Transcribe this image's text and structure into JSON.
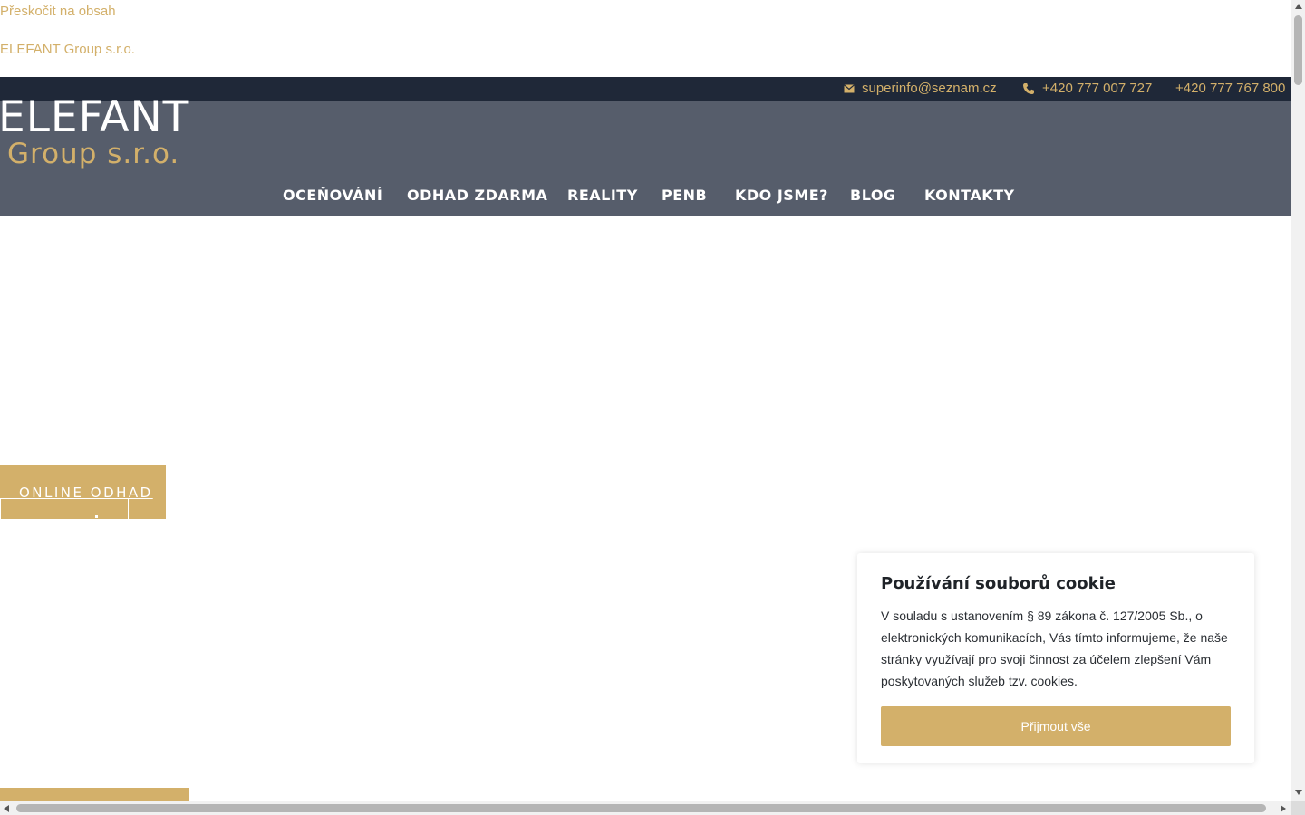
{
  "skip_link": "Přeskočit na obsah",
  "site_name": "ELEFANT Group s.r.o.",
  "topbar": {
    "email": "superinfo@seznam.cz",
    "phone1": "+420 777 007 727",
    "phone2": "+420 777 767 800",
    "email_icon": "mail-icon",
    "phone_icon": "phone-icon"
  },
  "logo": {
    "main": "ELEFANT",
    "sub": "Group s.r.o."
  },
  "nav": {
    "items": [
      {
        "label": "OCEŇOVÁNÍ"
      },
      {
        "label": "ODHAD ZDARMA"
      },
      {
        "label": "REALITY"
      },
      {
        "label": "PENB"
      },
      {
        "label": "KDO JSME?"
      },
      {
        "label": "BLOG"
      },
      {
        "label": "KONTAKTY"
      }
    ]
  },
  "cta": {
    "label": "ONLINE ODHAD"
  },
  "cookie": {
    "title": "Používání souborů cookie",
    "text": "V souladu s ustanovením § 89 zákona č. 127/2005 Sb., o elektronických komunikacích, Vás tímto informujeme, že naše stránky využívají pro svoji činnost za účelem zlepšení Vám poskytovaných služeb tzv. cookies.",
    "accept_label": "Přijmout vše"
  },
  "colors": {
    "accent": "#d3b06a",
    "topbar_bg": "#1f2838",
    "header_bg": "#565d6b",
    "text_dark": "#1f2328",
    "white": "#ffffff"
  }
}
